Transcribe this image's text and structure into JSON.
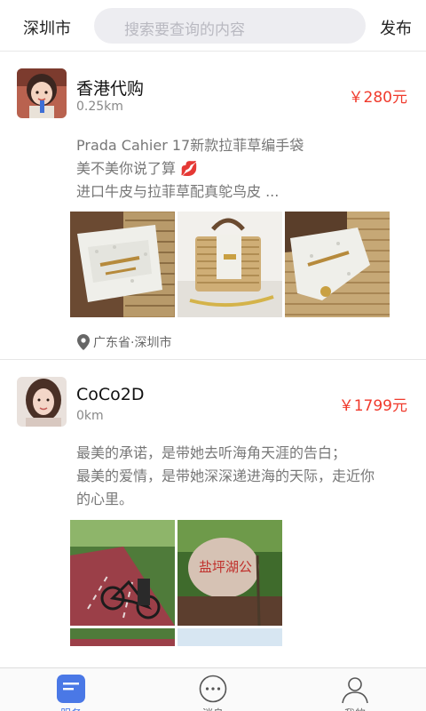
{
  "header": {
    "city": "深圳市",
    "search_placeholder": "搜索要查询的内容",
    "publish": "发布"
  },
  "posts": [
    {
      "username": "香港代购",
      "distance": "0.25km",
      "price": "￥280元",
      "desc_lines": [
        "Prada Cahier 17新款拉菲草编手袋",
        "美不美你说了算 💋",
        "进口牛皮与拉菲草配真鸵鸟皮 ..."
      ],
      "location": "广东省·深圳市"
    },
    {
      "username": "CoCo2D",
      "distance": "0km",
      "price": "￥1799元",
      "desc_lines": [
        "最美的承诺，是带她去听海角天涯的告白；",
        "最美的爱情，是带她深深递进海的天际，走近你",
        "的心里。"
      ],
      "stone_text": "盐坪湖公"
    }
  ],
  "tabbar": {
    "tabs": [
      {
        "label": "服务",
        "icon": "service-icon",
        "active": true
      },
      {
        "label": "消息",
        "icon": "message-icon",
        "active": false
      },
      {
        "label": "我的",
        "icon": "profile-icon",
        "active": false
      }
    ]
  },
  "colors": {
    "price": "#f03a2c",
    "accent": "#4a78e6",
    "search_bg": "#ededf1"
  }
}
